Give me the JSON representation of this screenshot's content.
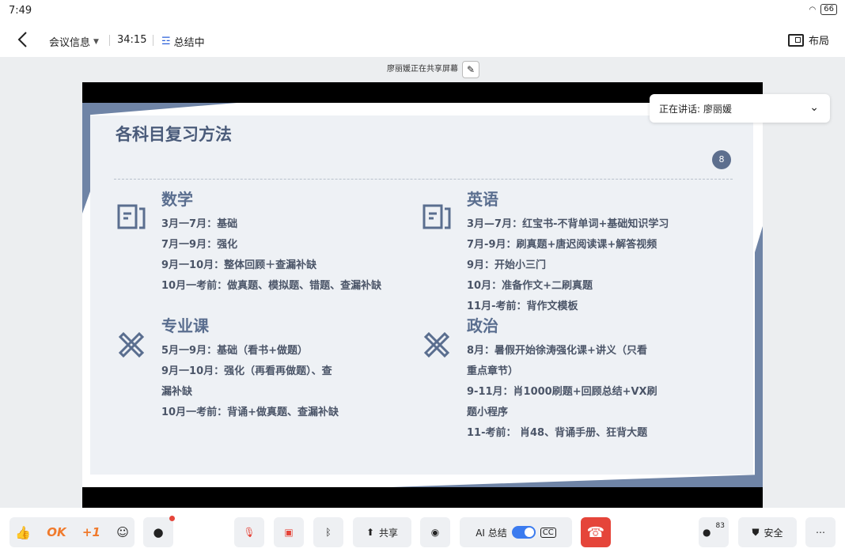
{
  "status": {
    "time": "7:49",
    "battery": "66"
  },
  "topbar": {
    "meeting_info": "会议信息",
    "duration": "34:15",
    "summarizing": "总结中",
    "layout": "布局"
  },
  "stage": {
    "sharing_text": "廖丽媛正在共享屏幕",
    "speaker_label": "正在讲话:",
    "speaker_name": "廖丽媛"
  },
  "slide": {
    "title": "各科目复习方法",
    "page": "8",
    "math": {
      "head": "数学",
      "lines": [
        "3月一7月：基础",
        "7月一9月：强化",
        "9月一10月：整体回顾＋查漏补缺",
        "10月一考前：做真题、模拟题、错题、查漏补缺"
      ]
    },
    "english": {
      "head": "英语",
      "lines": [
        "3月—7月：红宝书-不背单词+基础知识学习",
        "7月-9月：刷真题+唐迟阅读课+解答视频",
        "9月：开始小三门",
        "10月：准备作文+二刷真题",
        "11月-考前：背作文模板"
      ]
    },
    "major": {
      "head": "专业课",
      "lines": [
        "5月一9月：基础（看书+做题）",
        "9月一10月：强化（再看再做题）、查",
        "漏补缺",
        "10月一考前：背诵+做真题、查漏补缺"
      ]
    },
    "politics": {
      "head": "政治",
      "lines": [
        "8月：暑假开始徐涛强化课+讲义（只看",
        "重点章节）",
        "9-11月：肖1000刷题+回顾总结+VX刷",
        "题小程序",
        "11-考前： 肖48、背诵手册、狂背大题"
      ]
    }
  },
  "toolbar": {
    "ok": "OK",
    "plus_one": "+1",
    "share": "共享",
    "ai_summary": "AI 总结",
    "participants_count": "83",
    "security": "安全"
  }
}
